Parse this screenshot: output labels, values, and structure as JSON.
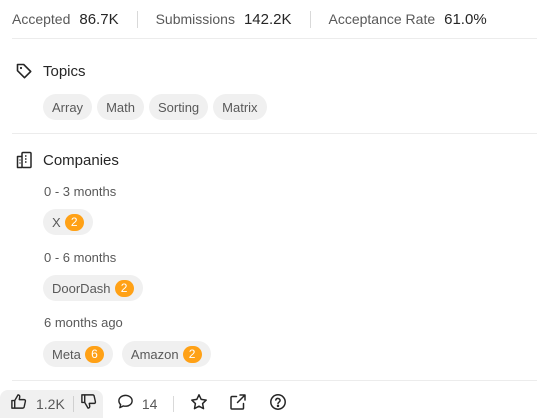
{
  "stats": [
    {
      "label": "Accepted",
      "value": "86.7K"
    },
    {
      "label": "Submissions",
      "value": "142.2K"
    },
    {
      "label": "Acceptance Rate",
      "value": "61.0%"
    }
  ],
  "topics": {
    "title": "Topics",
    "icon": "tag-icon",
    "tags": [
      "Array",
      "Math",
      "Sorting",
      "Matrix"
    ]
  },
  "companies": {
    "title": "Companies",
    "icon": "building-icon",
    "groups": [
      {
        "period": "0 - 3 months",
        "items": [
          {
            "name": "X",
            "count": "2"
          }
        ]
      },
      {
        "period": "0 - 6 months",
        "items": [
          {
            "name": "DoorDash",
            "count": "2"
          }
        ]
      },
      {
        "period": "6 months ago",
        "items": [
          {
            "name": "Meta",
            "count": "6"
          },
          {
            "name": "Amazon",
            "count": "2"
          }
        ]
      }
    ]
  },
  "bottom_bar": {
    "likes": "1.2K",
    "comments": "14",
    "icons": [
      "thumbs-up-icon",
      "thumbs-down-icon",
      "comment-icon",
      "star-icon",
      "share-icon",
      "help-icon"
    ]
  },
  "colors": {
    "badge": "#ffa116",
    "tag_bg": "#f0f0f0"
  }
}
